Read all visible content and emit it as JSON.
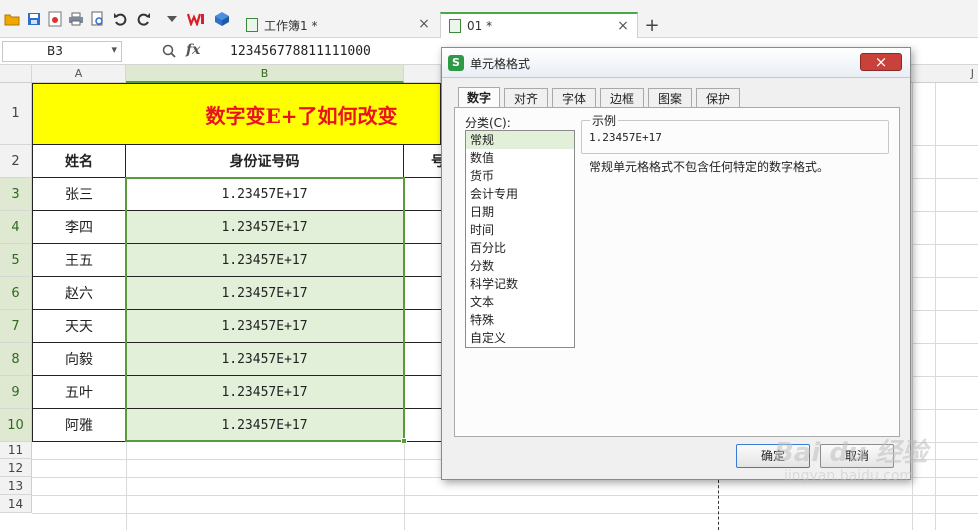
{
  "tabs": [
    {
      "label": "工作簿1 *",
      "close": "×"
    },
    {
      "label": "01 *",
      "close": "×"
    }
  ],
  "new_tab": "+",
  "formula_bar": {
    "cell_ref": "B3",
    "dropdown": "▾",
    "fx": "fx",
    "value": "123456778811111000"
  },
  "columns": [
    "A",
    "B"
  ],
  "right_col": "J",
  "rows": [
    "1",
    "2",
    "3",
    "4",
    "5",
    "6",
    "7",
    "8",
    "9",
    "10",
    "11",
    "12",
    "13",
    "14"
  ],
  "sheet": {
    "title": "数字变E+了如何改变",
    "header_name": "姓名",
    "header_id": "身份证号码",
    "header_partial": "号",
    "data": [
      {
        "name": "张三",
        "id": "1.23457E+17"
      },
      {
        "name": "李四",
        "id": "1.23457E+17"
      },
      {
        "name": "王五",
        "id": "1.23457E+17"
      },
      {
        "name": "赵六",
        "id": "1.23457E+17"
      },
      {
        "name": "天天",
        "id": "1.23457E+17"
      },
      {
        "name": "向毅",
        "id": "1.23457E+17"
      },
      {
        "name": "五叶",
        "id": "1.23457E+17"
      },
      {
        "name": "阿雅",
        "id": "1.23457E+17"
      }
    ]
  },
  "dialog": {
    "title": "单元格格式",
    "close": "×",
    "tabs": [
      "数字",
      "对齐",
      "字体",
      "边框",
      "图案",
      "保护"
    ],
    "category_label": "分类(C):",
    "categories": [
      "常规",
      "数值",
      "货币",
      "会计专用",
      "日期",
      "时间",
      "百分比",
      "分数",
      "科学记数",
      "文本",
      "特殊",
      "自定义"
    ],
    "sample_label": "示例",
    "sample_value": "1.23457E+17",
    "description": "常规单元格格式不包含任何特定的数字格式。",
    "ok_label": "确定",
    "cancel_label": "取消"
  },
  "watermark": {
    "brand": "Bai du 经验",
    "url": "jingyan.baidu.com"
  },
  "colors": {
    "title_bg": "#ffff00",
    "title_text": "#e8131f",
    "selection": "#e3f0d9",
    "selection_border": "#5a9a3a"
  }
}
